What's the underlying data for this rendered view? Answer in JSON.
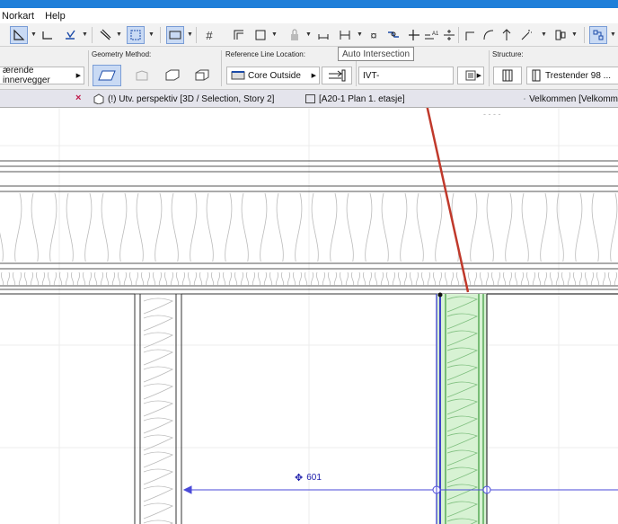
{
  "menu": {
    "items": [
      "Norkart",
      "Help"
    ]
  },
  "toolbar": {
    "tooltip": "Auto Intersection"
  },
  "infobox": {
    "layer_value": "ærende innervegger",
    "geometry_label": "Geometry Method:",
    "reference_label": "Reference Line Location:",
    "reference_value": "Core Outside",
    "ivt_value": "IVT-",
    "structure_label": "Structure:",
    "structure_value": "Trestender 98 ..."
  },
  "tabs": {
    "tab1": "(!) Utv. perspektiv [3D / Selection, Story 2]",
    "tab2": "[A20-1 Plan 1. etasje]",
    "tab3": "Velkommen [Velkomm"
  },
  "canvas": {
    "dimension_value": "601",
    "status_dots": "- - - -"
  },
  "colors": {
    "accent": "#1f7fd9",
    "wall_fill": "#d7f2d3",
    "wall_edge": "#3a9a3a",
    "dimension": "#4a4ad8",
    "arrow": "#c0392b"
  }
}
